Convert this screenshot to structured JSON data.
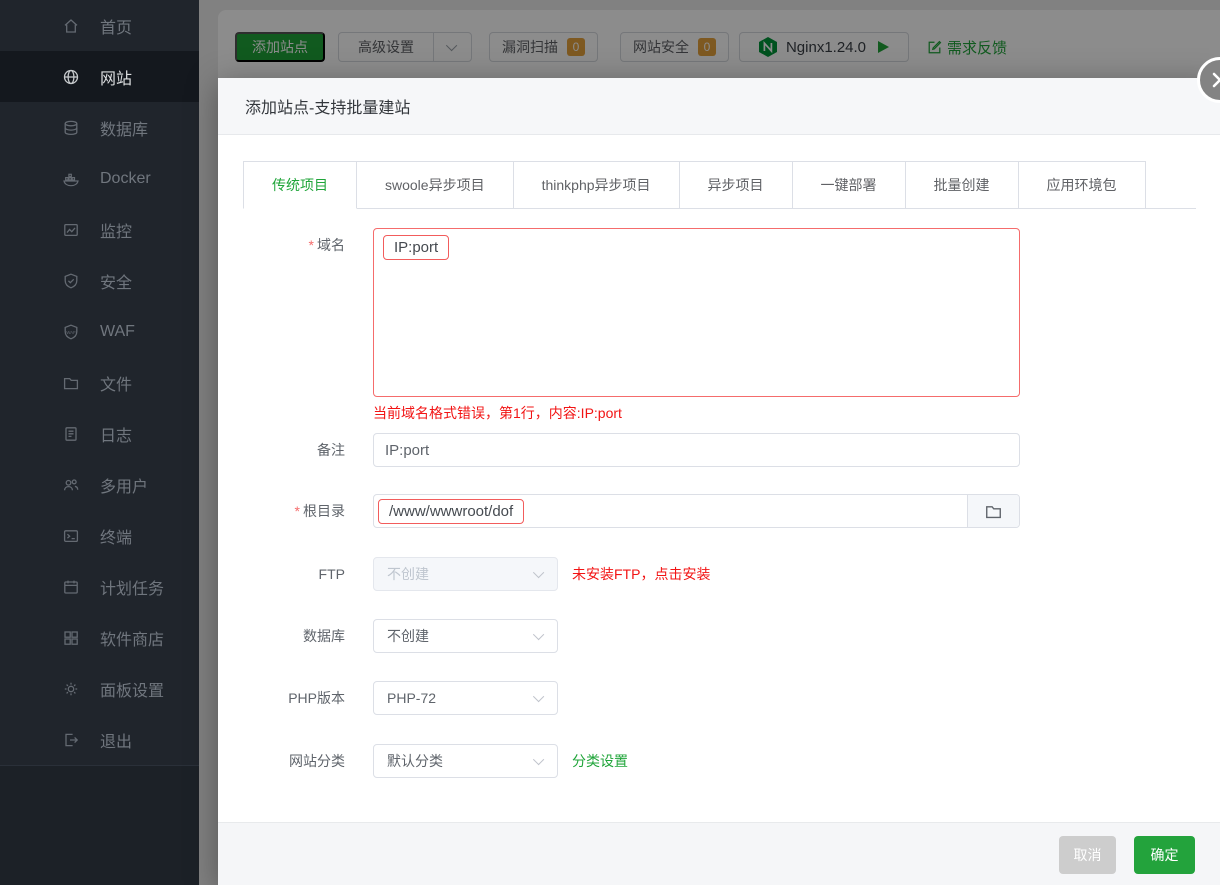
{
  "marks": {
    "required": "*"
  },
  "colors": {
    "accent_green": "#20a53a",
    "danger_red": "#f21414",
    "badge_orange": "#e6a23c",
    "field_error_border": "#f56c6c",
    "sidebar_bg": "#20252c",
    "overlay": "rgba(0,0,0,0.45)"
  },
  "sidebar": {
    "items": [
      {
        "label": "首页"
      },
      {
        "label": "网站",
        "active": true
      },
      {
        "label": "数据库"
      },
      {
        "label": "Docker"
      },
      {
        "label": "监控"
      },
      {
        "label": "安全"
      },
      {
        "label": "WAF"
      },
      {
        "label": "文件"
      },
      {
        "label": "日志"
      },
      {
        "label": "多用户"
      },
      {
        "label": "终端"
      },
      {
        "label": "计划任务"
      },
      {
        "label": "软件商店"
      },
      {
        "label": "面板设置"
      },
      {
        "label": "退出"
      }
    ]
  },
  "toolbar": {
    "add_site": "添加站点",
    "advanced": "高级设置",
    "scan": "漏洞扫描",
    "scan_badge": "0",
    "site_security": "网站安全",
    "security_badge": "0",
    "webserver": "Nginx1.24.0",
    "feedback": "需求反馈"
  },
  "modal": {
    "title": "添加站点-支持批量建站",
    "tabs": [
      {
        "label": "传统项目",
        "active": true
      },
      {
        "label": "swoole异步项目"
      },
      {
        "label": "thinkphp异步项目"
      },
      {
        "label": "异步项目"
      },
      {
        "label": "一键部署"
      },
      {
        "label": "批量创建"
      },
      {
        "label": "应用环境包"
      }
    ],
    "form": {
      "domain": {
        "label": "域名",
        "value": "IP:port",
        "error": "当前域名格式错误，第1行，内容:IP:port"
      },
      "note": {
        "label": "备注",
        "value": "IP:port"
      },
      "root": {
        "label": "根目录",
        "value": "/www/wwwroot/dof"
      },
      "ftp": {
        "label": "FTP",
        "value": "不创建",
        "warning": "未安装FTP，点击安装"
      },
      "database": {
        "label": "数据库",
        "value": "不创建"
      },
      "php": {
        "label": "PHP版本",
        "value": "PHP-72"
      },
      "category": {
        "label": "网站分类",
        "value": "默认分类",
        "link": "分类设置"
      }
    },
    "footer": {
      "cancel": "取消",
      "ok": "确定"
    }
  }
}
